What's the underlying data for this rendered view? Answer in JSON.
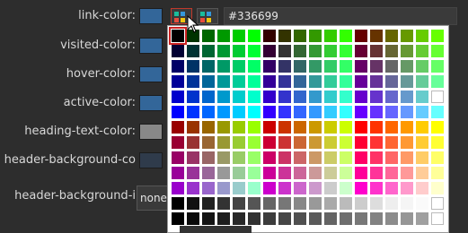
{
  "labels": {
    "link_color": "link-color:",
    "visited_color": "visited-color:",
    "hover_color": "hover-color:",
    "active_color": "active-color:",
    "heading_text_color": "heading-text-color:",
    "header_background_color": "header-background-co",
    "header_background_image": "header-background-i"
  },
  "link_color": {
    "hex": "#336699"
  },
  "header_background_image": {
    "value": "none"
  },
  "colors": {
    "link": "#336699",
    "heading": "#888888",
    "header_bg": "#2f3b4b",
    "selected_outline": "#cc2222"
  },
  "palette": [
    [
      "#000000",
      "#003300",
      "#006600",
      "#009900",
      "#00cc00",
      "#00ff00",
      "#330000",
      "#333300",
      "#336600",
      "#339900",
      "#33cc00",
      "#33ff00",
      "#660000",
      "#663300",
      "#666600",
      "#669900",
      "#66cc00",
      "#66ff00"
    ],
    [
      "#000033",
      "#003333",
      "#006633",
      "#009933",
      "#00cc33",
      "#00ff33",
      "#330033",
      "#333333",
      "#336633",
      "#339933",
      "#33cc33",
      "#33ff33",
      "#660033",
      "#663333",
      "#666633",
      "#669933",
      "#66cc33",
      "#66ff33"
    ],
    [
      "#000066",
      "#003366",
      "#006666",
      "#009966",
      "#00cc66",
      "#00ff66",
      "#330066",
      "#333366",
      "#336666",
      "#339966",
      "#33cc66",
      "#33ff66",
      "#660066",
      "#663366",
      "#666666",
      "#669966",
      "#66cc66",
      "#66ff66"
    ],
    [
      "#000099",
      "#003399",
      "#006699",
      "#009999",
      "#00cc99",
      "#00ff99",
      "#330099",
      "#333399",
      "#336699",
      "#339999",
      "#33cc99",
      "#33ff99",
      "#660099",
      "#663399",
      "#666699",
      "#669999",
      "#66cc99",
      "#66ff99"
    ],
    [
      "#0000cc",
      "#0033cc",
      "#0066cc",
      "#0099cc",
      "#00cccc",
      "#00ffcc",
      "#3300cc",
      "#3333cc",
      "#3366cc",
      "#3399cc",
      "#33cccc",
      "#33ffcc",
      "#6600cc",
      "#6633cc",
      "#6666cc",
      "#6699cc",
      "#66cccc",
      "#ffffff"
    ],
    [
      "#0000ff",
      "#0033ff",
      "#0066ff",
      "#0099ff",
      "#00ccff",
      "#00ffff",
      "#3300ff",
      "#3333ff",
      "#3366ff",
      "#3399ff",
      "#33ccff",
      "#33ffff",
      "#6600ff",
      "#6633ff",
      "#6666ff",
      "#6699ff",
      "#66ccff",
      "#66ffff"
    ],
    [
      "#990000",
      "#993300",
      "#996600",
      "#999900",
      "#99cc00",
      "#99ff00",
      "#cc0000",
      "#cc3300",
      "#cc6600",
      "#cc9900",
      "#cccc00",
      "#ccff00",
      "#ff0000",
      "#ff3300",
      "#ff6600",
      "#ff9900",
      "#ffcc00",
      "#ffff00"
    ],
    [
      "#990033",
      "#993333",
      "#996633",
      "#999933",
      "#99cc33",
      "#99ff33",
      "#cc0033",
      "#cc3333",
      "#cc6633",
      "#cc9933",
      "#cccc33",
      "#ccff33",
      "#ff0033",
      "#ff3333",
      "#ff6633",
      "#ff9933",
      "#ffcc33",
      "#ffff33"
    ],
    [
      "#990066",
      "#993366",
      "#996666",
      "#999966",
      "#99cc66",
      "#99ff66",
      "#cc0066",
      "#cc3366",
      "#cc6666",
      "#cc9966",
      "#cccc66",
      "#ccff66",
      "#ff0066",
      "#ff3366",
      "#ff6666",
      "#ff9966",
      "#ffcc66",
      "#ffff66"
    ],
    [
      "#990099",
      "#993399",
      "#996699",
      "#999999",
      "#99cc99",
      "#99ff99",
      "#cc0099",
      "#cc3399",
      "#cc6699",
      "#cc9999",
      "#cccc99",
      "#ccff99",
      "#ff0099",
      "#ff3399",
      "#ff6699",
      "#ff9999",
      "#ffcc99",
      "#ffff99"
    ],
    [
      "#9900cc",
      "#9933cc",
      "#9966cc",
      "#9999cc",
      "#99cccc",
      "#99ffcc",
      "#cc00cc",
      "#cc33cc",
      "#cc66cc",
      "#cc99cc",
      "#cccccc",
      "#ccffcc",
      "#ff00cc",
      "#ff33cc",
      "#ff66cc",
      "#ff99cc",
      "#ffcccc",
      "#ffffcc"
    ],
    [
      "#000000",
      "#111111",
      "#222222",
      "#333333",
      "#444444",
      "#555555",
      "#666666",
      "#777777",
      "#888888",
      "#999999",
      "#aaaaaa",
      "#bbbbbb",
      "#cccccc",
      "#dddddd",
      "#eeeeee",
      "#f5f5f5",
      "#fafafa",
      "#ffffff"
    ],
    [
      "#000000",
      "#0a0a0a",
      "#141414",
      "#1e1e1e",
      "#282828",
      "#323232",
      "#3c3c3c",
      "#464646",
      "#505050",
      "#5a5a5a",
      "#646464",
      "#6e6e6e",
      "#787878",
      "#828282",
      "#8c8c8c",
      "#969696",
      "#a0a0a0",
      "#ffffff"
    ]
  ],
  "selected_cell": [
    0,
    0
  ]
}
